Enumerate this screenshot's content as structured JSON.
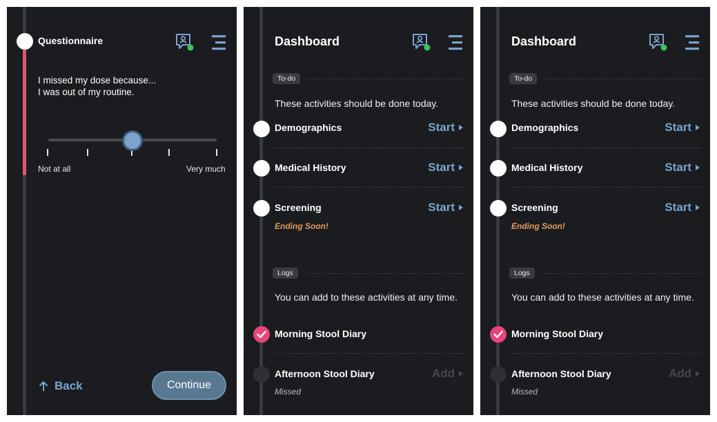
{
  "colors": {
    "background": "#1b1c1f",
    "accent": "#7ba3cc",
    "progress": "#e0566e",
    "warning": "#e29a5c",
    "check": "#e8457a",
    "online": "#3cc35a"
  },
  "questionnaire": {
    "title": "Questionnaire",
    "question_line1": "I missed my dose because...",
    "question_line2": "I was out of my routine.",
    "slider": {
      "min_label": "Not at all",
      "max_label": "Very much",
      "steps": 5,
      "selected_step": 3
    },
    "back_label": "Back",
    "continue_label": "Continue",
    "icons": {
      "support": "support-chat-icon",
      "menu": "menu-icon",
      "back": "arrow-up-icon"
    }
  },
  "dashboard": {
    "title": "Dashboard",
    "todo": {
      "badge": "To-do",
      "description": "These activities should be done today.",
      "items": [
        {
          "name": "Demographics",
          "action": "Start",
          "note": ""
        },
        {
          "name": "Medical History",
          "action": "Start",
          "note": ""
        },
        {
          "name": "Screening",
          "action": "Start",
          "note": "Ending Soon!"
        }
      ]
    },
    "logs": {
      "badge": "Logs",
      "description": "You can add to these activities at any time.",
      "items": [
        {
          "name": "Morning Stool Diary",
          "status": "completed",
          "action": "",
          "note": ""
        },
        {
          "name": "Afternoon Stool Diary",
          "status": "missed",
          "action": "Add",
          "note": "Missed"
        }
      ]
    }
  }
}
